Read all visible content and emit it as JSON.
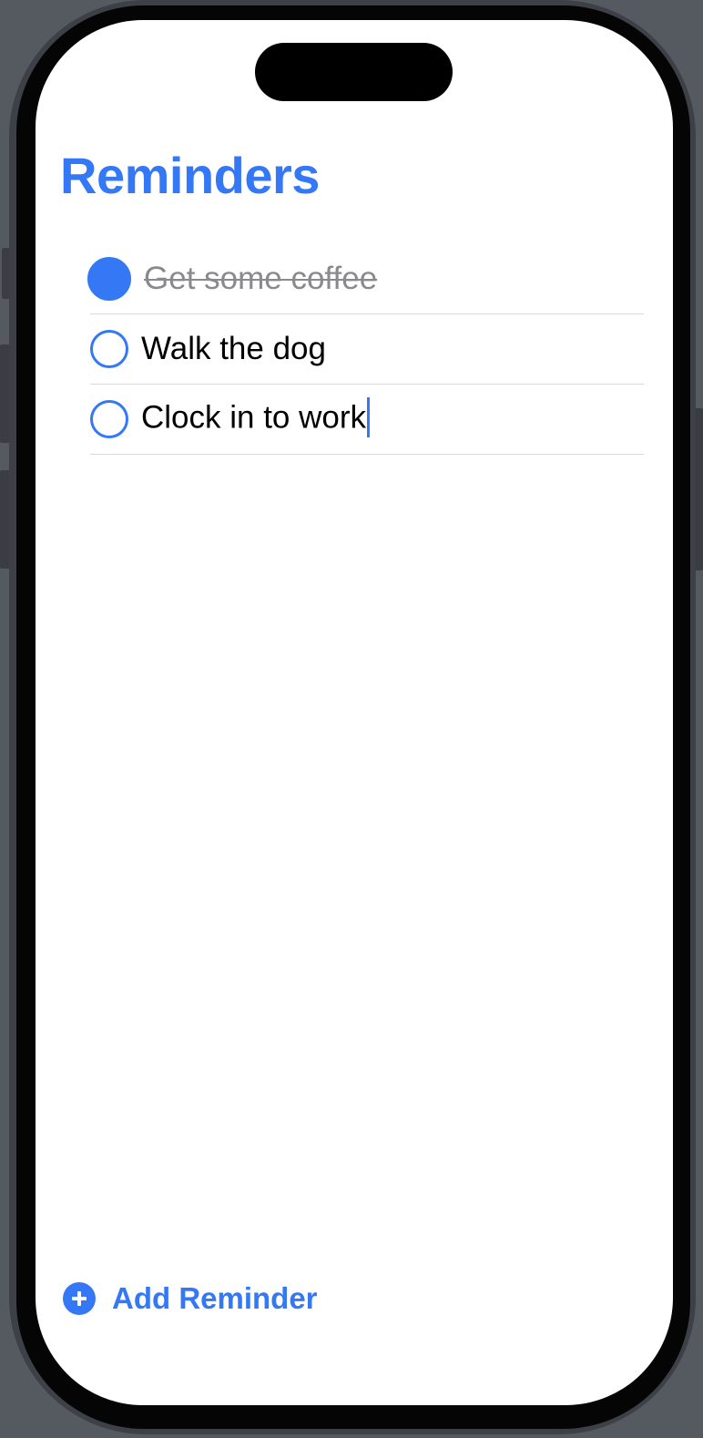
{
  "app": {
    "title": "Reminders"
  },
  "reminders": [
    {
      "text": "Get some coffee",
      "completed": true
    },
    {
      "text": "Walk the dog",
      "completed": false
    },
    {
      "text": "Clock in to work",
      "completed": false,
      "editing": true
    }
  ],
  "footer": {
    "add_label": "Add Reminder",
    "add_icon": "plus-circle-icon"
  },
  "colors": {
    "accent": "#3478f6",
    "completed_text": "#8a8a8e",
    "separator": "#d9d9de"
  }
}
